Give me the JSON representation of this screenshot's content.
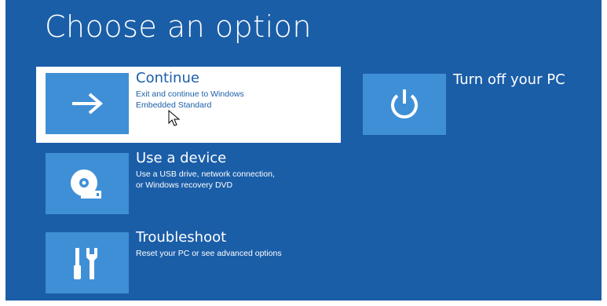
{
  "page": {
    "title": "Choose an option"
  },
  "options": [
    {
      "heading": "Continue",
      "desc_line1": "Exit and continue to Windows",
      "desc_line2": "Embedded Standard",
      "icon": "arrow-right-icon"
    },
    {
      "heading": "Use a device",
      "desc_line1": "Use a USB drive, network connection,",
      "desc_line2": "or Windows recovery DVD",
      "icon": "disc-drive-icon"
    },
    {
      "heading": "Troubleshoot",
      "desc_line1": "Reset your PC or see advanced options",
      "icon": "tools-icon"
    },
    {
      "heading": "Turn off your PC",
      "icon": "power-icon"
    }
  ],
  "colors": {
    "background": "#1b5ea8",
    "tile": "#3f8fd6",
    "selected": "#ffffff"
  }
}
